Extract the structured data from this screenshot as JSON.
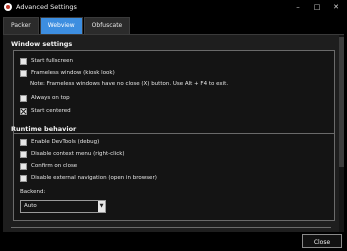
{
  "window": {
    "title": "Advanced Settings",
    "controls": [
      "–",
      "□",
      "✕"
    ]
  },
  "tabs": [
    {
      "label": "Packer",
      "active": false
    },
    {
      "label": "Webview",
      "active": true
    },
    {
      "label": "Obfuscate",
      "active": false
    }
  ],
  "window_settings": {
    "title": "Window settings",
    "start_fullscreen": {
      "label": "Start fullscreen",
      "checked": false
    },
    "frameless": {
      "label": "Frameless window (kiosk look)",
      "checked": false
    },
    "frameless_note": "Note: Frameless windows have no close (X) button. Use Alt + F4 to exit.",
    "always_on_top": {
      "label": "Always on top",
      "checked": false
    },
    "start_centered": {
      "label": "Start centered",
      "checked": true
    }
  },
  "runtime_behavior": {
    "title": "Runtime behavior",
    "devtools": {
      "label": "Enable DevTools (debug)",
      "checked": false
    },
    "disable_context_menu": {
      "label": "Disable context menu (right-click)",
      "checked": false
    },
    "confirm_on_close": {
      "label": "Confirm on close",
      "checked": false
    },
    "disable_external_nav": {
      "label": "Disable external navigation (open in browser)",
      "checked": false
    },
    "backend_label": "Backend:",
    "backend_value": "Auto"
  },
  "footer": {
    "close_label": "Close"
  }
}
